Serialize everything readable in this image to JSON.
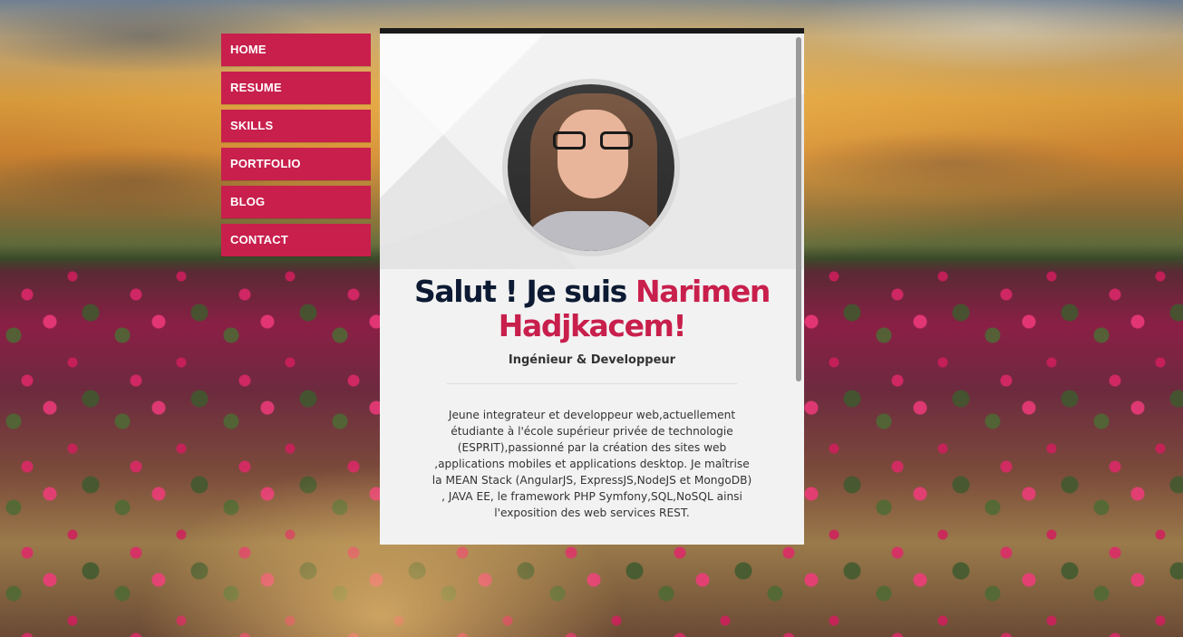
{
  "nav": {
    "items": [
      {
        "label": "HOME"
      },
      {
        "label": "RESUME"
      },
      {
        "label": "SKILLS"
      },
      {
        "label": "PORTFOLIO"
      },
      {
        "label": "BLOG"
      },
      {
        "label": "CONTACT"
      }
    ]
  },
  "profile": {
    "greeting": "Salut ! Je suis",
    "name": "Narimen Hadjkacem!",
    "role": "Ingénieur & Developpeur",
    "bio": "Jeune integrateur et developpeur web,actuellement étudiante à l'école supérieur privée de technologie (ESPRIT),passionné par la création des sites web ,applications mobiles et applications desktop. Je maîtrise la MEAN Stack (AngularJS, ExpressJS,NodeJS et MongoDB) , JAVA EE, le framework PHP Symfony,SQL,NoSQL ainsi l'exposition des web services REST."
  },
  "colors": {
    "accent": "#c81f4c",
    "title_dark": "#0d1a33",
    "card_bg": "#f2f2f2"
  }
}
